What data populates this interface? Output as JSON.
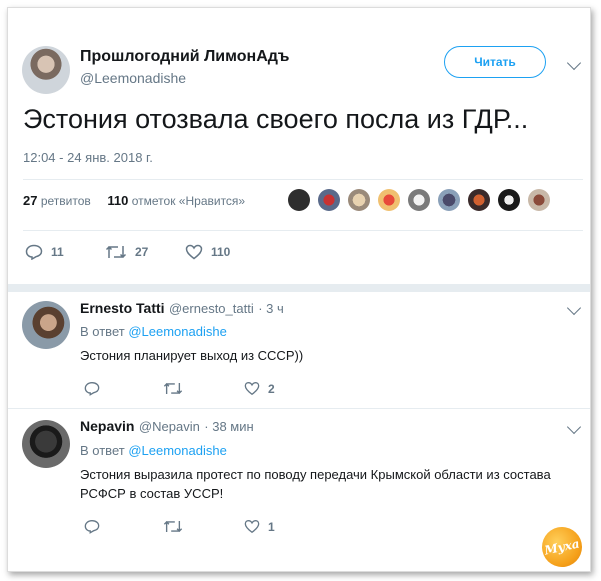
{
  "main_tweet": {
    "author_name": "Прошлогодний ЛимонАдъ",
    "author_handle": "@Leemonadishe",
    "follow_label": "Читать",
    "text": "Эстония отозвала своего посла из ГДР...",
    "timestamp": "12:04 - 24 янв. 2018 г.",
    "retweets_count": "27",
    "retweets_label": "ретвитов",
    "likes_count": "110",
    "likes_label": "отметок «Нравится»",
    "actions": {
      "reply_count": "11",
      "retweet_count": "27",
      "like_count": "110"
    }
  },
  "replies": [
    {
      "author_name": "Ernesto Tatti",
      "author_handle": "@ernesto_tatti",
      "time": "· 3 ч",
      "reply_to_prefix": "В ответ",
      "reply_to_handle": "@Leemonadishe",
      "text": "Эстония планирует выход из СССР))",
      "like_count": "2"
    },
    {
      "author_name": "Nepavin",
      "author_handle": "@Nepavin",
      "time": "· 38 мин",
      "reply_to_prefix": "В ответ",
      "reply_to_handle": "@Leemonadishe",
      "text_line1": "Эстония выразила протест по поводу передачи Крымской области из состава",
      "text_line2": "РСФСР в состав УССР!",
      "like_count": "1"
    }
  ],
  "watermark": "Муха",
  "colors": {
    "accent": "#1da1f2",
    "muted": "#657786",
    "text": "#14171a",
    "divider": "#e6ecf0"
  }
}
